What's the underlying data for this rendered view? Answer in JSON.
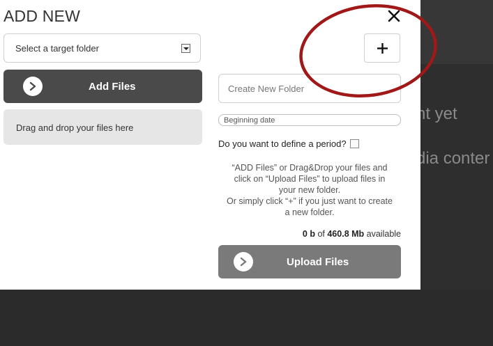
{
  "background": {
    "text_line1": "nt yet",
    "text_line2": "dia conter"
  },
  "modal": {
    "title": "ADD NEW",
    "close_icon": "close-icon",
    "left": {
      "target_folder_select": {
        "value": "Select a target folder",
        "options": [
          "Select a target folder"
        ]
      },
      "add_files_label": "Add Files",
      "drop_zone_text": "Drag and drop your files here"
    },
    "right": {
      "add_folder_icon": "plus-icon",
      "new_folder_placeholder": "Create New Folder",
      "beginning_date_placeholder": "Beginning date",
      "period_question": "Do you want to define a period?",
      "period_checked": false,
      "help_lines": [
        "“ADD Files” or Drag&Drop your files and",
        "click on “Upload Files” to upload files in",
        "your new folder.",
        "Or simply click “+” if you just want to create",
        "a new folder."
      ],
      "storage": {
        "used": "0 b",
        "of": "of",
        "total": "460.8 Mb",
        "suffix": "available"
      },
      "upload_label": "Upload Files"
    }
  },
  "colors": {
    "dark_button": "#4a4a4a",
    "upload_button": "#7a7a7a",
    "annotation_circle": "#a01818",
    "page_background": "#2b2b2b"
  }
}
